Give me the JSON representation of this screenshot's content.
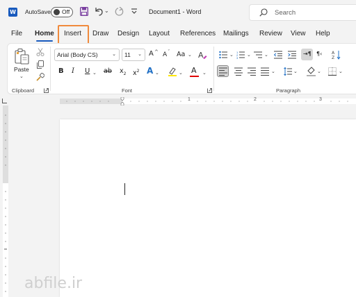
{
  "titlebar": {
    "app_icon_letter": "W",
    "autosave_label": "AutoSave",
    "autosave_state": "Off",
    "document_title": "Document1  -  Word",
    "search_placeholder": "Search"
  },
  "tabs": [
    "File",
    "Home",
    "Insert",
    "Draw",
    "Design",
    "Layout",
    "References",
    "Mailings",
    "Review",
    "View",
    "Help"
  ],
  "active_tab": "Home",
  "highlighted_tab": "Insert",
  "highlight_color": "#f08a3c",
  "accent_color": "#185abd",
  "clipboard": {
    "paste_label": "Paste",
    "group_label": "Clipboard"
  },
  "font": {
    "font_name": "Arial (Body CS)",
    "font_size": "11",
    "grow_glyph": "A",
    "shrink_glyph": "A",
    "case_glyph": "Aa",
    "bold": "B",
    "italic": "I",
    "underline": "U",
    "strike": "ab",
    "subscript": "x",
    "superscript": "x",
    "effects_glyph": "A",
    "font_color_glyph": "A",
    "group_label": "Font"
  },
  "paragraph": {
    "group_label": "Paragraph"
  },
  "ruler": {
    "numbers": [
      "1",
      "2",
      "3"
    ]
  },
  "watermark": "abfile.ir"
}
